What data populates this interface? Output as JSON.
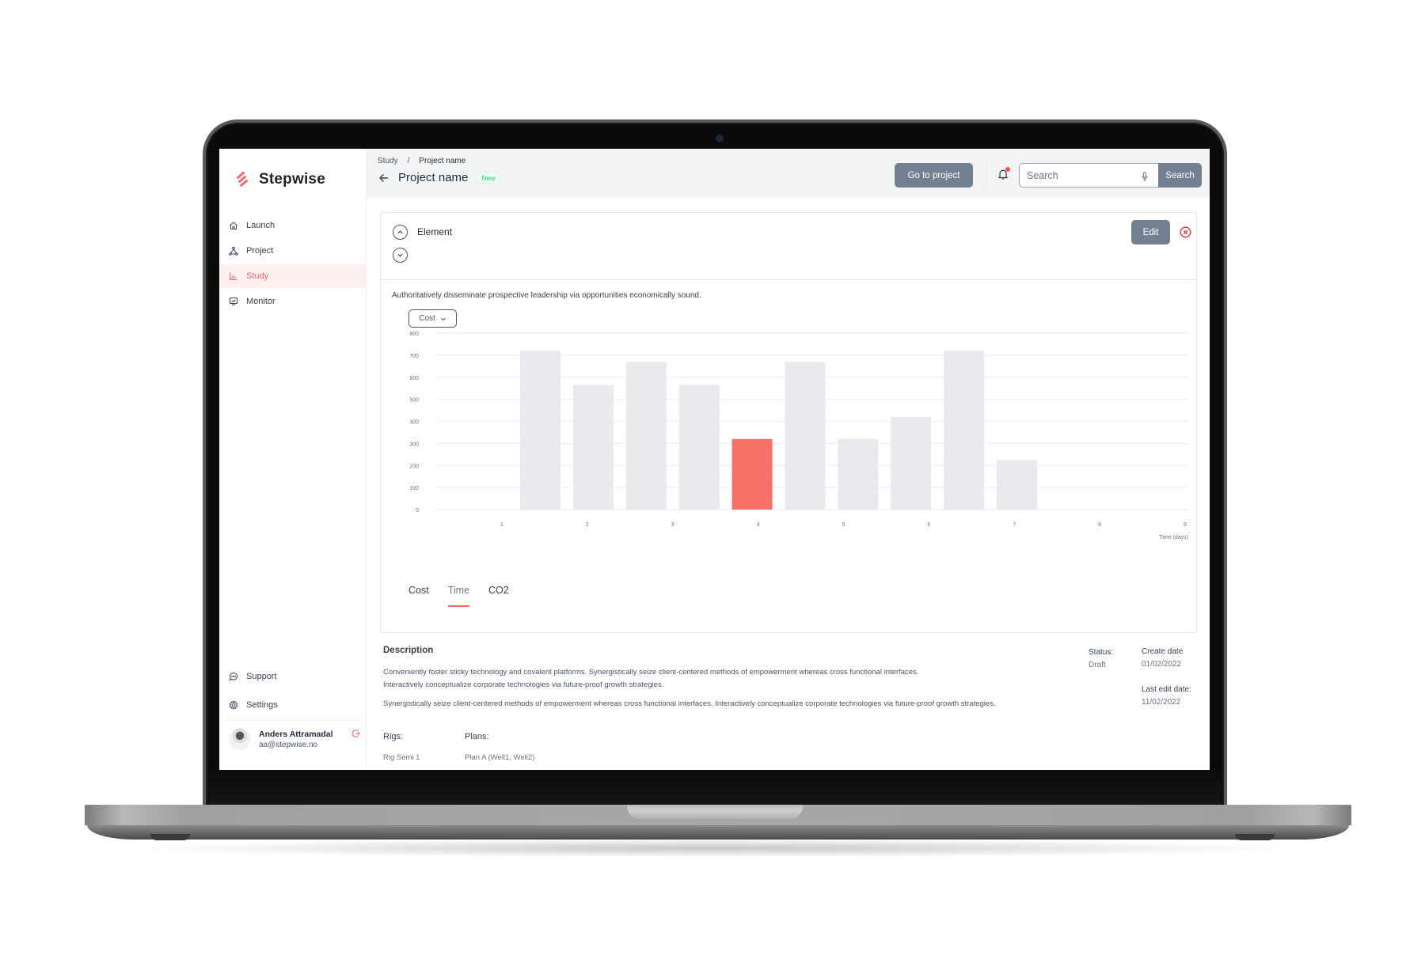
{
  "app": {
    "brand": "Stepwise",
    "accent_color": "#f46a6a",
    "button_color": "#738091"
  },
  "sidebar": {
    "items": [
      {
        "label": "Launch",
        "icon": "home-icon",
        "active": false
      },
      {
        "label": "Project",
        "icon": "project-nodes-icon",
        "active": false
      },
      {
        "label": "Study",
        "icon": "bar-chart-icon",
        "active": true
      },
      {
        "label": "Monitor",
        "icon": "monitor-icon",
        "active": false
      }
    ],
    "bottom_items": [
      {
        "label": "Support",
        "icon": "chat-bubble-icon"
      },
      {
        "label": "Settings",
        "icon": "gear-icon"
      }
    ],
    "user": {
      "name": "Anders Attramadal",
      "email": "aa@stepwise.no"
    }
  },
  "header": {
    "breadcrumb": [
      "Study",
      "/",
      "Project name"
    ],
    "title": "Project name",
    "badge": "New",
    "go_to_project": "Go to project",
    "search_placeholder": "Search",
    "search_button": "Search"
  },
  "card": {
    "title": "Element",
    "edit_label": "Edit",
    "description": "Authoritatively disseminate prospective leadership via opportunities economically sound.",
    "select_value": "Cost",
    "tabs": [
      {
        "label": "Cost",
        "active": false
      },
      {
        "label": "Time",
        "active": true
      },
      {
        "label": "CO2",
        "active": false
      }
    ]
  },
  "chart_data": {
    "type": "bar",
    "title": "",
    "xlabel": "Time (days)",
    "ylabel": "",
    "ylim": [
      0,
      800
    ],
    "yticks": [
      0,
      100,
      200,
      300,
      400,
      500,
      600,
      700,
      800
    ],
    "xticks": [
      "1",
      "2",
      "3",
      "4",
      "5",
      "6",
      "7",
      "8",
      "9"
    ],
    "xlim": [
      1,
      9
    ],
    "grid": true,
    "bars": [
      {
        "x": 1.45,
        "value": 720,
        "highlight": false
      },
      {
        "x": 2.07,
        "value": 565,
        "highlight": false
      },
      {
        "x": 2.69,
        "value": 670,
        "highlight": false
      },
      {
        "x": 3.31,
        "value": 565,
        "highlight": false
      },
      {
        "x": 3.93,
        "value": 320,
        "highlight": true
      },
      {
        "x": 4.55,
        "value": 670,
        "highlight": false
      },
      {
        "x": 5.17,
        "value": 320,
        "highlight": false
      },
      {
        "x": 5.79,
        "value": 420,
        "highlight": false
      },
      {
        "x": 6.41,
        "value": 720,
        "highlight": false
      },
      {
        "x": 7.03,
        "value": 225,
        "highlight": false
      }
    ],
    "bar_color": "#e9eaee",
    "highlight_color": "#f87168"
  },
  "details": {
    "description_title": "Description",
    "paragraph1_line1": "Conveniently foster sticky technology and covalent platforms. Synergistically seize client-centered methods of empowerment whereas cross functional interfaces.",
    "paragraph1_line2": "Interactively conceptualize corporate technologies via future-proof growth strategies.",
    "paragraph2": "Synergistically seize client-centered methods of empowerment whereas cross functional interfaces. Interactively conceptualize corporate technologies via future-proof growth strategies.",
    "status_label": "Status:",
    "status_value": "Draft",
    "create_date_label": "Create date",
    "create_date_value": "01/02/2022",
    "last_edit_label": "Last edit date:",
    "last_edit_value": "11/02/2022",
    "rigs_label": "Rigs:",
    "rigs_value": "Rig Semi 1",
    "plans_label": "Plans:",
    "plans_value": "Plan A (Well1, Well2)"
  }
}
